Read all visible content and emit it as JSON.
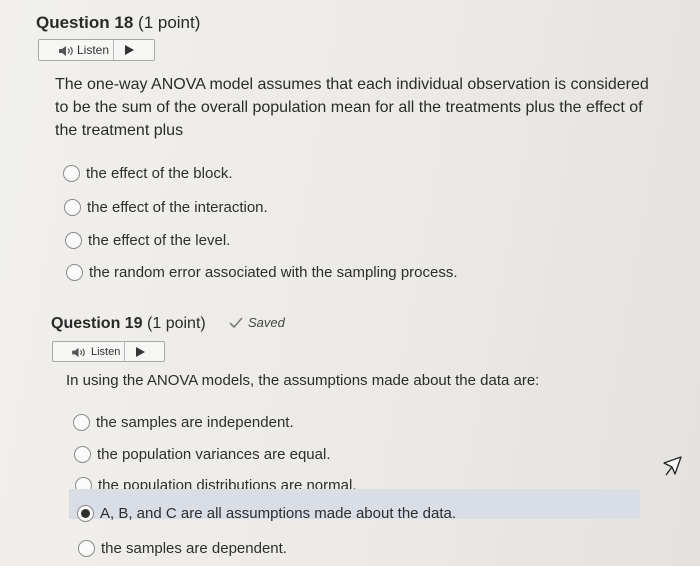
{
  "q18": {
    "title_bold": "Question 18",
    "title_rest": " (1 point)",
    "listen_label": "Listen",
    "question_line1": "The one-way ANOVA model assumes that each individual observation is considered",
    "question_line2": "to be the sum of the overall population mean for all the treatments plus the effect of",
    "question_line3": "the treatment plus",
    "options": [
      "the effect of the block.",
      "the effect of the interaction.",
      "the effect of the level.",
      "the random error associated with the sampling process."
    ]
  },
  "q19": {
    "title_bold": "Question 19",
    "title_rest": " (1 point)",
    "saved_label": "Saved",
    "listen_label": "Listen",
    "question": "In using the ANOVA models, the assumptions made about the data are:",
    "options": [
      "the samples are independent.",
      "the population variances are equal.",
      "the population distributions are normal.",
      "A, B, and C are all assumptions made about the data.",
      "the samples are dependent."
    ],
    "selected_option": "A, B, and C are all assumptions made about the data."
  }
}
